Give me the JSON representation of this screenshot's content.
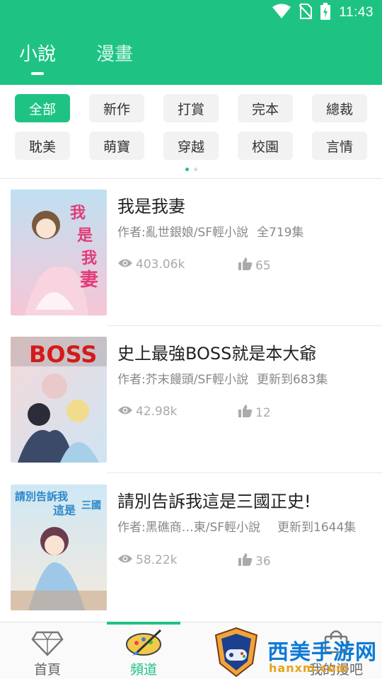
{
  "status_bar": {
    "time": "11:43",
    "icons": [
      "wifi-icon",
      "no-sim-icon",
      "battery-charging-icon"
    ]
  },
  "header": {
    "tabs": [
      {
        "label": "小說",
        "active": true
      },
      {
        "label": "漫畫",
        "active": false
      }
    ]
  },
  "categories": {
    "row1": [
      "全部",
      "新作",
      "打賞",
      "完本",
      "總裁"
    ],
    "row2": [
      "耽美",
      "萌寶",
      "穿越",
      "校園",
      "言情"
    ],
    "active": "全部",
    "page_dots": 2,
    "current_page": 1
  },
  "books": [
    {
      "title": "我是我妻",
      "author": "作者:亂世銀娘/SF輕小說",
      "episodes": "全719集",
      "views": "403.06k",
      "likes": "65",
      "cover_text": "我是我妻",
      "cover_colors": [
        "#f6c6d6",
        "#f9e7ee"
      ]
    },
    {
      "title": "史上最強BOSS就是本大爺",
      "author": "作者:芥末饅頭/SF輕小說",
      "episodes": "更新到683集",
      "views": "42.98k",
      "likes": "12",
      "cover_text": "BOSS",
      "cover_colors": [
        "#f4d9d9",
        "#cfe4f3"
      ]
    },
    {
      "title": "請別告訴我這是三國正史!",
      "author": "作者:黑礁商…東/SF輕小說",
      "episodes": "更新到1644集",
      "views": "58.22k",
      "likes": "36",
      "cover_text": "請別告訴我",
      "cover_colors": [
        "#cfe8f5",
        "#f2e9dc"
      ]
    }
  ],
  "bottom_nav": [
    {
      "label": "首頁",
      "icon": "diamond-icon",
      "active": false
    },
    {
      "label": "頻道",
      "icon": "paint-palette-icon",
      "active": true
    },
    {
      "label": "",
      "icon": "game-controller-shield-icon",
      "active": false
    },
    {
      "label": "我的漫吧",
      "icon": "shopping-bag-icon",
      "active": false
    }
  ],
  "watermark": {
    "text": "西美手游网",
    "url": "hanxm.com"
  },
  "colors": {
    "brand_green": "#1ec384",
    "text_gray": "#888888",
    "chip_bg": "#f2f2f2"
  }
}
